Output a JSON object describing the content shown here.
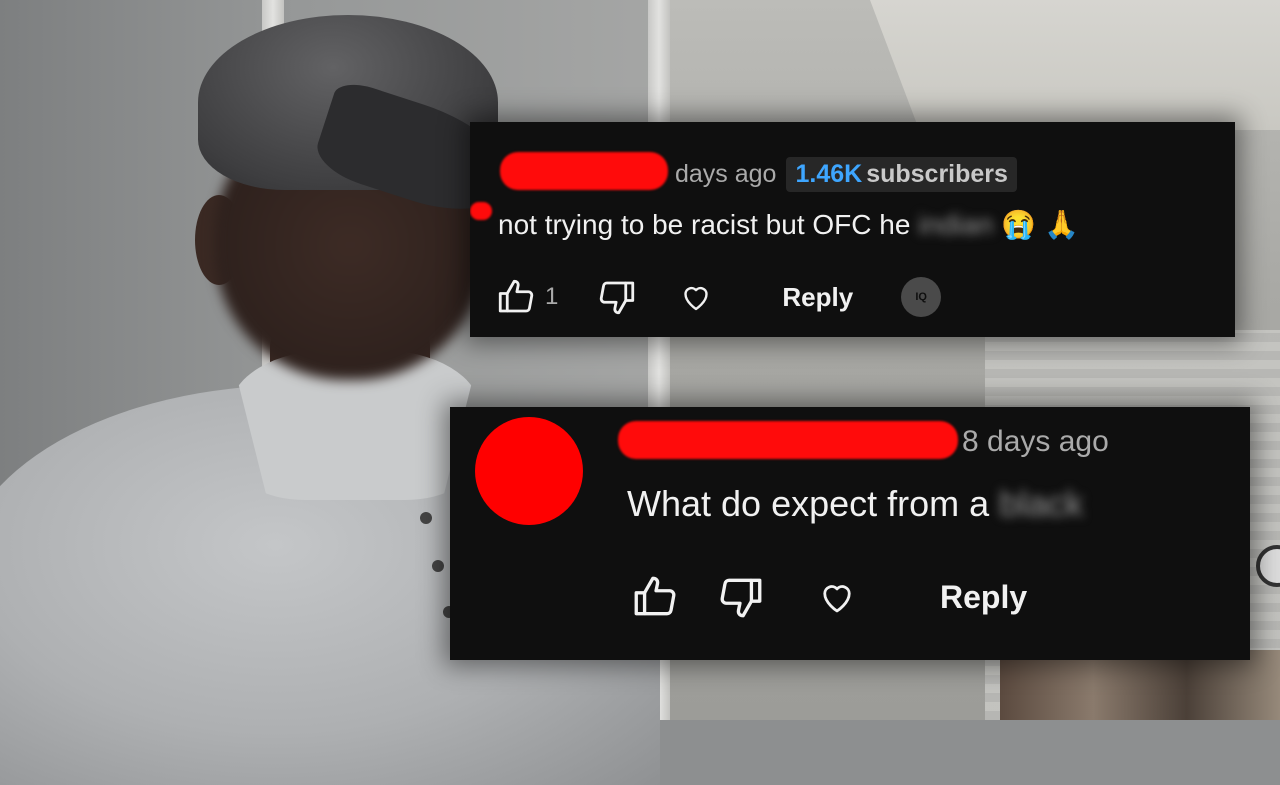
{
  "colors": {
    "card_bg": "#0f0f0f",
    "redaction": "#ff0b0b",
    "subscriber_blue": "#3ea6ff",
    "meta_gray": "#aaaaaa"
  },
  "comment1": {
    "timestamp": "days ago",
    "subscriber_count": "1.46K",
    "subscriber_label": "subscribers",
    "text": "not trying to be racist but OFC he",
    "blurred_word": "indian",
    "emojis": [
      "😭",
      "🙏"
    ],
    "like_count": "1",
    "reply_label": "Reply",
    "icons": [
      "thumbs-up-icon",
      "thumbs-down-icon",
      "heart-icon",
      "badge-icon"
    ],
    "badge_text": "IQ"
  },
  "comment2": {
    "timestamp": "8 days ago",
    "text": "What do expect from a",
    "blurred_word": "black",
    "reply_label": "Reply",
    "icons": [
      "thumbs-up-icon",
      "thumbs-down-icon",
      "heart-icon"
    ]
  }
}
